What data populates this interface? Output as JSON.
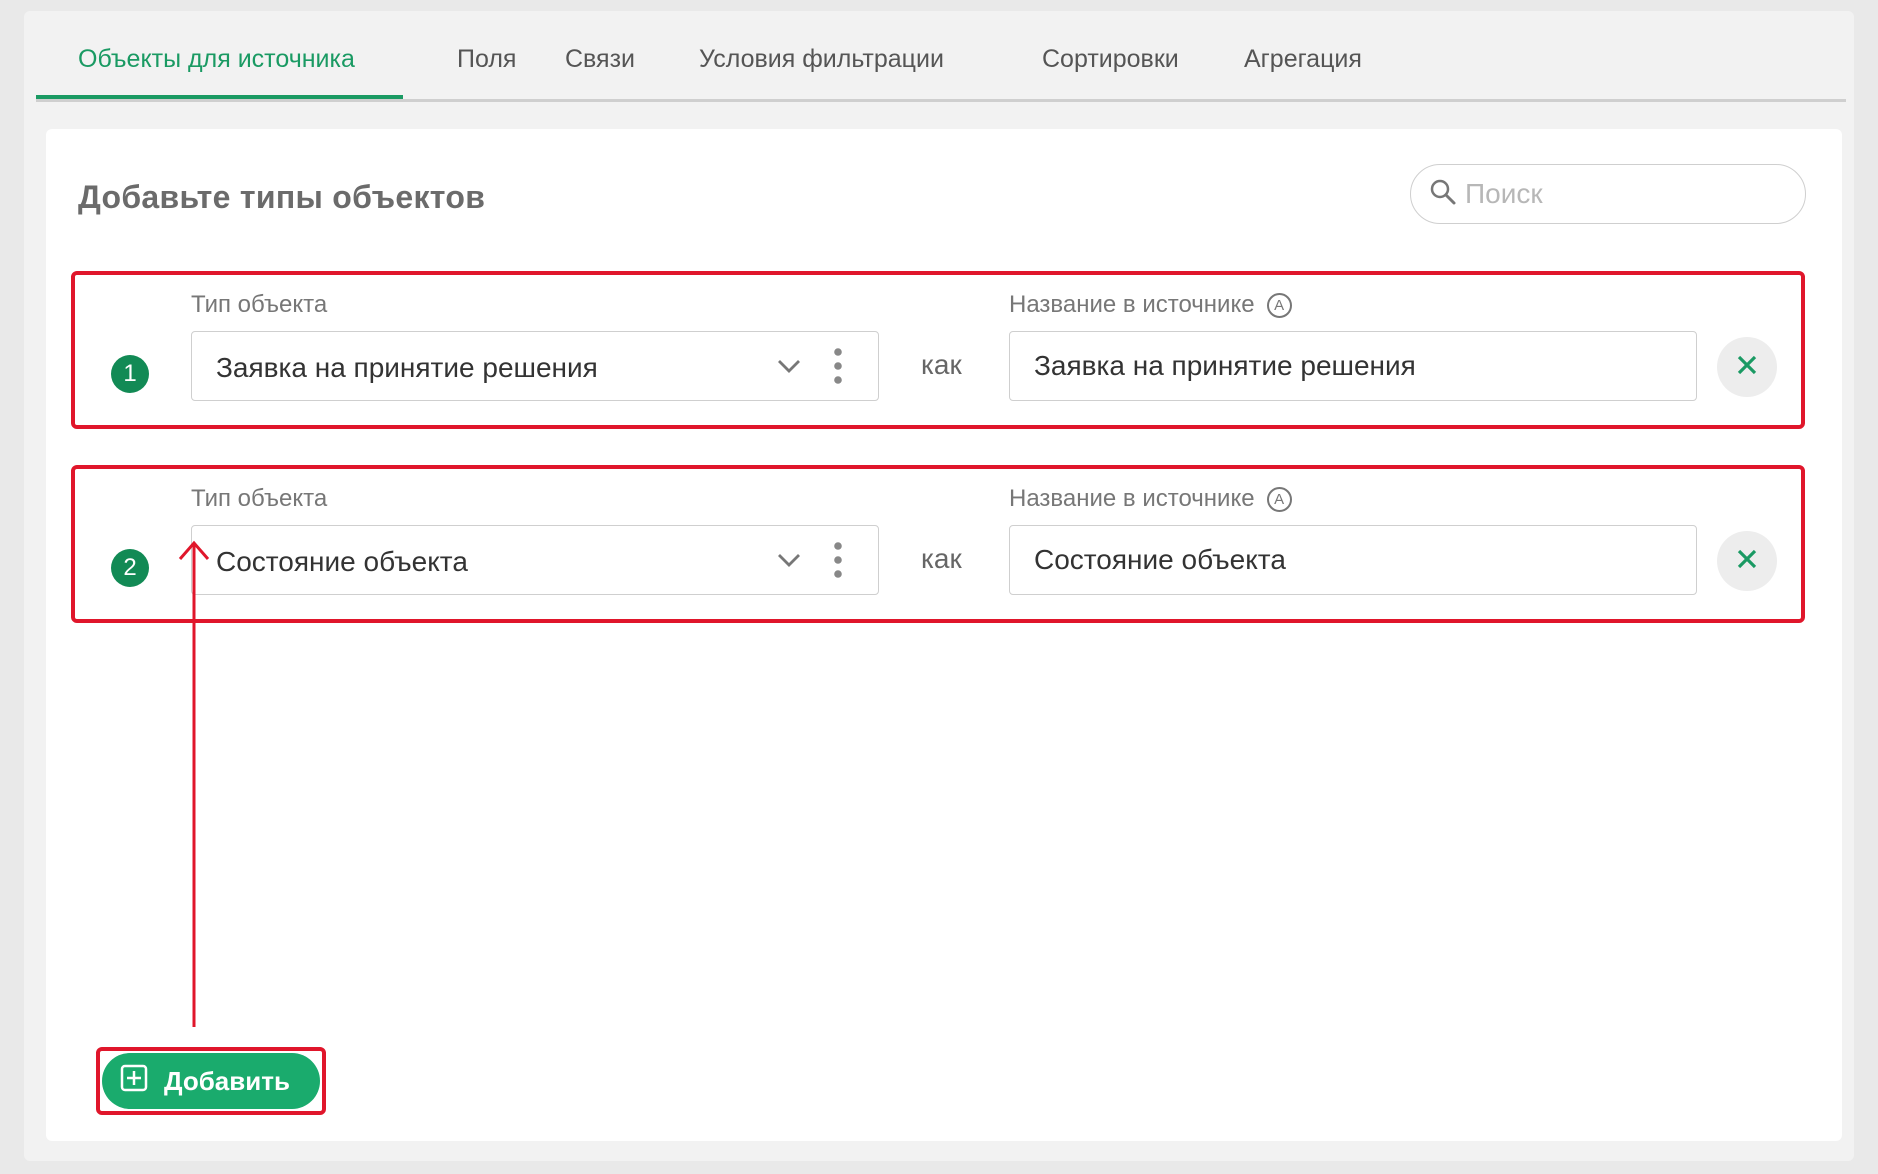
{
  "tabs": [
    {
      "label": "Объекты для источника",
      "active": true
    },
    {
      "label": "Поля",
      "active": false
    },
    {
      "label": "Связи",
      "active": false
    },
    {
      "label": "Условия фильтрации",
      "active": false
    },
    {
      "label": "Сортировки",
      "active": false
    },
    {
      "label": "Агрегация",
      "active": false
    }
  ],
  "card": {
    "title": "Добавьте типы объектов",
    "search_placeholder": "Поиск"
  },
  "rows": [
    {
      "number": "1",
      "type_label": "Тип объекта",
      "type_value": "Заявка на принятие решения",
      "as_text": "как",
      "name_label": "Название в источнике",
      "name_value": "Заявка на принятие решения"
    },
    {
      "number": "2",
      "type_label": "Тип объекта",
      "type_value": "Состояние объекта",
      "as_text": "как",
      "name_label": "Название в источнике",
      "name_value": "Состояние объекта"
    }
  ],
  "add_button": {
    "label": "Добавить"
  },
  "colors": {
    "accent": "#1a9a63",
    "button": "#1aab6d",
    "highlight": "#e0162b"
  },
  "icons": {
    "search": "search-icon",
    "chevron": "chevron-down-icon",
    "more": "more-vertical-icon",
    "remove": "close-icon",
    "auto": "auto-a-icon",
    "add": "plus-square-icon"
  }
}
